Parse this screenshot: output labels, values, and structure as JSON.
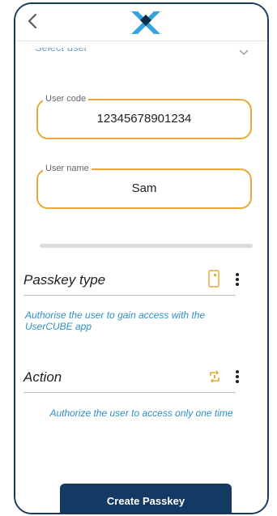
{
  "header": {
    "back_icon": "chevron-left-icon",
    "logo_icon": "cube-x-logo"
  },
  "form": {
    "select_user_label": "Select user",
    "user_code": {
      "label": "User code",
      "value": "12345678901234"
    },
    "user_name": {
      "label": "User name",
      "value": "Sam"
    }
  },
  "passkey_type": {
    "title": "Passkey type",
    "icon": "phone-app-icon",
    "description": "Authorise the user to gain access with the UserCUBE app"
  },
  "action": {
    "title": "Action",
    "icon": "repeat-once-icon",
    "description": "Authorize the user to access only one time"
  },
  "footer": {
    "create_label": "Create Passkey"
  },
  "colors": {
    "primary": "#133a63",
    "accent": "#e8a93b",
    "link": "#2f8fc4"
  }
}
